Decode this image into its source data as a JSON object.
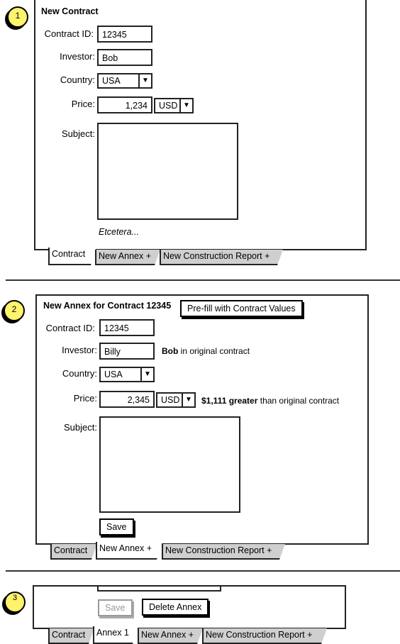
{
  "section1": {
    "bubble": "1",
    "title": "New Contract",
    "fields": {
      "contract_id": {
        "label": "Contract ID:",
        "value": "12345"
      },
      "investor": {
        "label": "Investor:",
        "value": "Bob"
      },
      "country": {
        "label": "Country:",
        "value": "USA"
      },
      "price": {
        "label": "Price:",
        "value": "1,234",
        "currency": "USD"
      },
      "subject": {
        "label": "Subject:",
        "value": ""
      }
    },
    "etcetera": "Etcetera...",
    "tabs": [
      {
        "label": "Contract",
        "active": true
      },
      {
        "label": "New Annex +",
        "active": false
      },
      {
        "label": "New Construction Report +",
        "active": false
      }
    ]
  },
  "section2": {
    "bubble": "2",
    "title": "New Annex for Contract 12345",
    "prefill_button": "Pre-fill with Contract Values",
    "fields": {
      "contract_id": {
        "label": "Contract ID:",
        "value": "12345"
      },
      "investor": {
        "label": "Investor:",
        "value": "Billy",
        "note_bold": "Bob",
        "note_rest": " in original contract"
      },
      "country": {
        "label": "Country:",
        "value": "USA"
      },
      "price": {
        "label": "Price:",
        "value": "2,345",
        "currency": "USD",
        "note_bold": "$1,111 greater",
        "note_rest": " than original contract"
      },
      "subject": {
        "label": "Subject:",
        "value": ""
      }
    },
    "save_button": "Save",
    "tabs": [
      {
        "label": "Contract",
        "active": false
      },
      {
        "label": "New Annex +",
        "active": true
      },
      {
        "label": "New Construction Report +",
        "active": false
      }
    ]
  },
  "section3": {
    "bubble": "3",
    "save_button": "Save",
    "delete_button": "Delete Annex",
    "tabs": [
      {
        "label": "Contract",
        "active": false
      },
      {
        "label": "Annex 1",
        "active": true
      },
      {
        "label": "New Annex +",
        "active": false
      },
      {
        "label": "New Construction Report +",
        "active": false
      }
    ]
  },
  "colors": {
    "bubble": "#fdf36c",
    "inactive_tab": "#cfcfcf"
  }
}
